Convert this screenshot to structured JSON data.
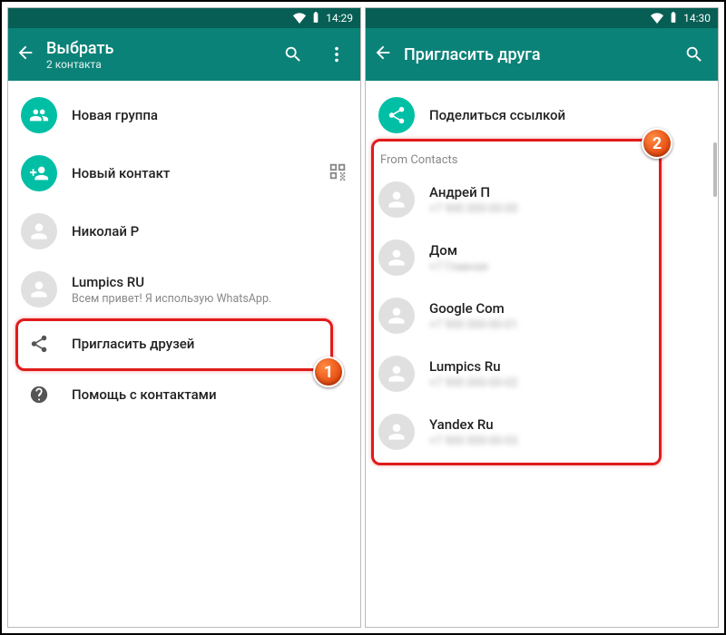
{
  "left": {
    "statusbar": {
      "time": "14:29"
    },
    "appbar": {
      "title": "Выбрать",
      "subtitle": "2 контакта"
    },
    "rows": {
      "new_group": "Новая группа",
      "new_contact": "Новый контакт",
      "contact1": {
        "name": "Николай Р"
      },
      "contact2": {
        "name": "Lumpics RU",
        "status": "Всем привет! Я использую WhatsApp."
      },
      "invite": "Пригласить друзей",
      "help": "Помощь с контактами"
    },
    "badge": "1"
  },
  "right": {
    "statusbar": {
      "time": "14:30"
    },
    "appbar": {
      "title": "Пригласить друга"
    },
    "share_link": "Поделиться ссылкой",
    "section": "From Contacts",
    "contacts": [
      {
        "name": "Андрей П",
        "sub": "+7 900 000-00-00"
      },
      {
        "name": "Дом",
        "sub": "+7 Главная"
      },
      {
        "name": "Google Com",
        "sub": "+7 900 000-00-01"
      },
      {
        "name": "Lumpics Ru",
        "sub": "+7 900 000-00-02"
      },
      {
        "name": "Yandex Ru",
        "sub": "+7 900 000-00-03"
      }
    ],
    "badge": "2"
  }
}
